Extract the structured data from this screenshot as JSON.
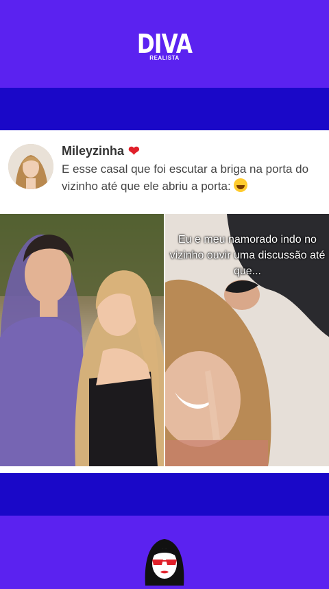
{
  "brand": {
    "name": "DIVA",
    "tagline": "REALISTA"
  },
  "post": {
    "username": "Mileyzinha",
    "text": "E esse casal que foi escutar a briga na porta do vizinho até que ele abriu a porta:",
    "overlay_caption": "Eu e meu namorado indo no vizinho ouvir uma discussão até que..."
  },
  "colors": {
    "top_bg": "#5b22f0",
    "band_bg": "#1a08c8",
    "card_bg": "#ffffff"
  },
  "icons": [
    "heart-icon",
    "laughing-emoji-icon",
    "diva-face-icon"
  ]
}
